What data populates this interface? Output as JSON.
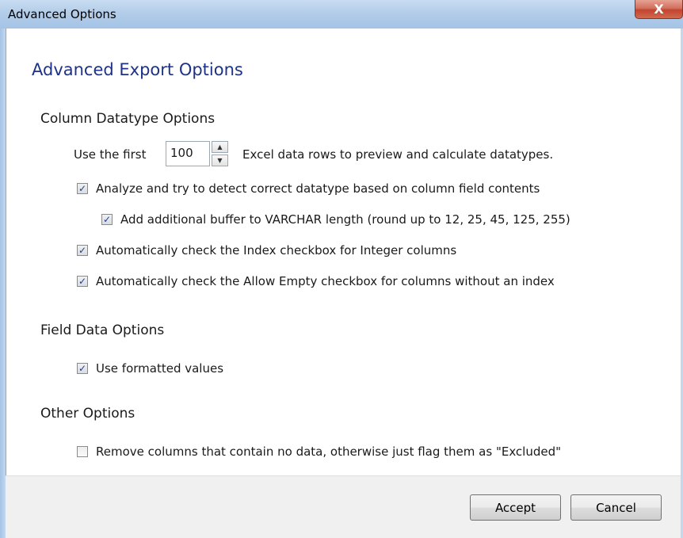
{
  "window": {
    "title": "Advanced Options",
    "close_glyph": "X"
  },
  "heading": "Advanced Export Options",
  "column_datatype": {
    "section_title": "Column Datatype Options",
    "preview_prefix": "Use the first",
    "preview_rows_value": "100",
    "preview_suffix": "Excel data rows to preview and calculate datatypes.",
    "options": [
      {
        "label": "Analyze and try to detect correct datatype based on column field contents",
        "checked": true
      },
      {
        "label": "Add additional buffer to VARCHAR length (round up to 12, 25, 45, 125, 255)",
        "checked": true
      },
      {
        "label": "Automatically check the Index checkbox for Integer columns",
        "checked": true
      },
      {
        "label": "Automatically check the Allow Empty checkbox for columns without an index",
        "checked": true
      }
    ]
  },
  "field_data": {
    "section_title": "Field Data Options",
    "options": [
      {
        "label": "Use formatted values",
        "checked": true
      }
    ]
  },
  "other": {
    "section_title": "Other Options",
    "options": [
      {
        "label": "Remove columns that contain no data, otherwise just flag them as \"Excluded\"",
        "checked": false
      }
    ]
  },
  "buttons": {
    "accept": "Accept",
    "cancel": "Cancel"
  },
  "colors": {
    "heading": "#1e3287",
    "titlebar": "#b3cde9",
    "close_button": "#c2442f"
  },
  "icons": {
    "close": "close-icon",
    "spin_up": "chevron-up-icon",
    "spin_down": "chevron-down-icon",
    "checkbox": "checkmark-icon"
  }
}
